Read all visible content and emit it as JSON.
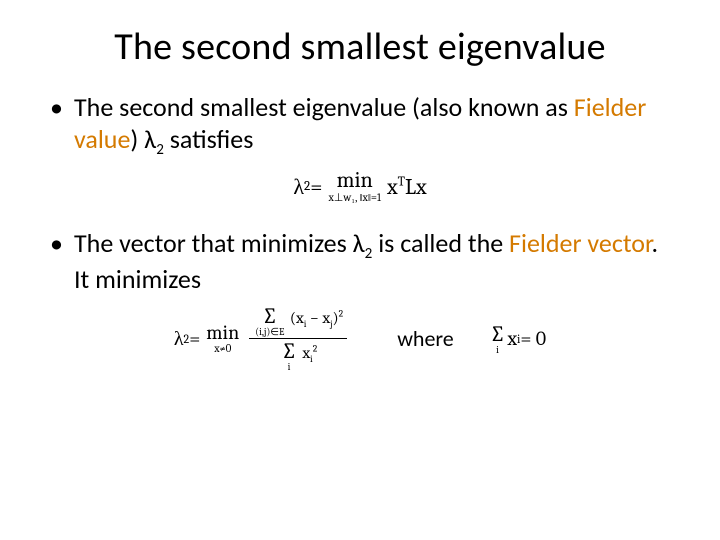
{
  "title": "The second smallest eigenvalue",
  "bullets": {
    "b1_pre": "The second smallest eigenvalue (also known as ",
    "b1_orange": "Fielder value",
    "b1_post_paren": ") ",
    "b1_lambda": "λ",
    "b1_sub": "2",
    "b1_tail": " satisfies",
    "b2_pre": "The vector that minimizes ",
    "b2_lambda": "λ",
    "b2_sub": "2",
    "b2_mid": " is called the ",
    "b2_orange": "Fielder vector",
    "b2_tail": ". It minimizes"
  },
  "eq1": {
    "lhs_l": "λ",
    "lhs_sub": "2",
    "eq": " = ",
    "min": "min",
    "cond": "x⊥w₁, ‖x‖=1",
    "rhs_x": "x",
    "rhs_T": "T",
    "rhs_L": "L",
    "rhs_x2": "x"
  },
  "eq2": {
    "lhs_l": "λ",
    "lhs_sub": "2",
    "eq": " = ",
    "min": "min",
    "cond": "x≠0",
    "num_sigma": "∑",
    "num_lim": "(i,j)∈E",
    "num_expr_open": "(x",
    "num_expr_i": "i",
    "num_expr_mid": " − x",
    "num_expr_j": "j",
    "num_expr_close": ")",
    "num_expr_pow": "2",
    "den_sigma": "∑",
    "den_lim": "i",
    "den_x": "x",
    "den_i": "i",
    "den_pow": "2",
    "where": "where",
    "sum_sigma": "∑",
    "sum_lim": "i",
    "sum_x": "x",
    "sum_i": "i",
    "sum_eq": " = 0"
  }
}
